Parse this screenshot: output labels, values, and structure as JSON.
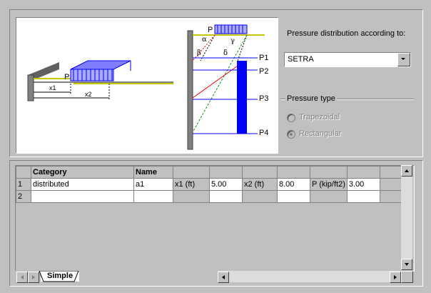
{
  "diagram": {
    "labels": {
      "p_left": "P",
      "x1": "x1",
      "x2": "x2",
      "p_right": "P",
      "alpha": "α",
      "beta": "β",
      "gamma": "γ",
      "delta": "δ",
      "p1": "P1",
      "p2": "P2",
      "p3": "P3",
      "p4": "P4"
    }
  },
  "settings": {
    "distribution_label": "Pressure distribution according to:",
    "distribution_value": "SETRA",
    "pressure_type_label": "Pressure type",
    "options": [
      "Trapezoidal",
      "Rectangular"
    ],
    "selected_option": "Rectangular"
  },
  "grid": {
    "columns": [
      "Category",
      "Name",
      "",
      "",
      "",
      "",
      "",
      "",
      ""
    ],
    "rows": [
      {
        "num": "1",
        "cells": [
          "distributed",
          "a1",
          "x1 (ft)",
          "5.00",
          "x2 (ft)",
          "8.00",
          "P (kip/ft2)",
          "3.00",
          ""
        ]
      },
      {
        "num": "2",
        "cells": [
          "",
          "",
          "",
          "",
          "",
          "",
          "",
          "",
          ""
        ]
      }
    ]
  },
  "tabs": [
    "Simple"
  ],
  "colors": {
    "accent_blue": "#0000ff",
    "window_bg": "#c0c0c0"
  }
}
